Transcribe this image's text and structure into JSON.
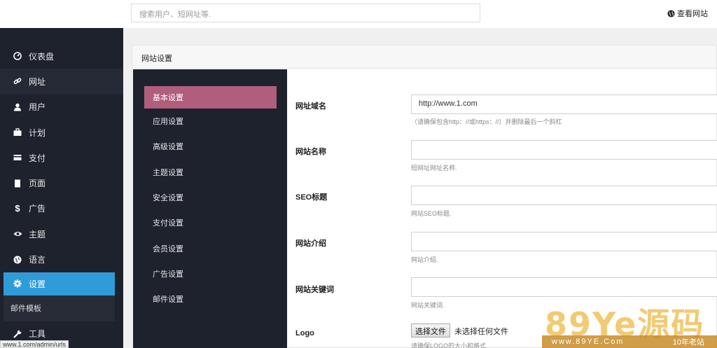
{
  "header": {
    "search_placeholder": "搜索用户、短网址等.",
    "view_site": "查看网站"
  },
  "sidebar": {
    "items": [
      {
        "label": "仪表盘",
        "icon": "dashboard-icon"
      },
      {
        "label": "网址",
        "icon": "link-icon"
      },
      {
        "label": "用户",
        "icon": "user-icon"
      },
      {
        "label": "计划",
        "icon": "briefcase-icon"
      },
      {
        "label": "支付",
        "icon": "credit-card-icon"
      },
      {
        "label": "页面",
        "icon": "page-icon"
      },
      {
        "label": "广告",
        "icon": "dollar-icon"
      },
      {
        "label": "主题",
        "icon": "eye-icon"
      },
      {
        "label": "语言",
        "icon": "globe-icon"
      },
      {
        "label": "设置",
        "icon": "gear-icon"
      },
      {
        "label": "工具",
        "icon": "wrench-icon"
      }
    ],
    "sub_item": "邮件模板"
  },
  "panel": {
    "title": "网站设置",
    "tabs": [
      "基本设置",
      "应用设置",
      "高级设置",
      "主题设置",
      "安全设置",
      "支付设置",
      "会员设置",
      "广告设置",
      "邮件设置"
    ]
  },
  "form": {
    "url_label": "网址域名",
    "url_value": "http://www.1.com",
    "url_help": "（请确保包含http：//或https：//）并删除最后一个斜杠",
    "name_label": "网站名称",
    "name_value": "",
    "name_help": "短网址网址名称.",
    "seo_label": "SEO标题",
    "seo_value": "",
    "seo_help": "网站SEO标题.",
    "desc_label": "网站介绍",
    "desc_value": "",
    "desc_help": "网站介绍.",
    "kw_label": "网站关键词",
    "kw_value": "",
    "kw_help": "网站关键词.",
    "logo_label": "Logo",
    "file_button": "选择文件",
    "file_status": "未选择任何文件",
    "logo_help": "请确保LOGO的大小和格式"
  },
  "status_url": "www.1.com/admin/urls",
  "watermark": {
    "big": "89Ye源码",
    "site": "www.89YE.Com",
    "slogan": "10年老站"
  },
  "colors": {
    "sidebar_bg": "#1e222d",
    "active_nav": "#2f9bd9",
    "active_tab": "#b05e7b"
  }
}
